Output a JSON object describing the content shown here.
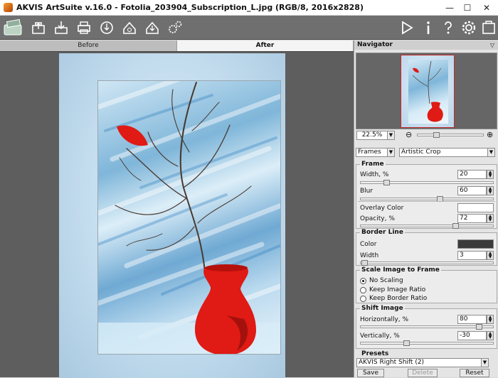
{
  "window": {
    "title": "AKVIS ArtSuite v.16.0 - Fotolia_203904_Subscription_L.jpg (RGB/8, 2016x2828)",
    "minimize": "—",
    "maximize": "☐",
    "close": "✕"
  },
  "tabs": {
    "before": "Before",
    "after": "After"
  },
  "navigator": {
    "title": "Navigator",
    "zoom": "22.5%",
    "zoom_out": "⊖",
    "zoom_in": "⊕"
  },
  "effect": {
    "category": "Frames",
    "frame_type": "Artistic Crop"
  },
  "frame": {
    "title": "Frame",
    "width_label": "Width, %",
    "width_value": "20",
    "width_level": 0.2,
    "blur_label": "Blur",
    "blur_value": "60",
    "blur_level": 0.6,
    "overlay_color_label": "Overlay Color",
    "overlay_color": "#ffffff",
    "opacity_label": "Opacity, %",
    "opacity_value": "72",
    "opacity_level": 0.72
  },
  "border_line": {
    "title": "Border Line",
    "color_label": "Color",
    "color": "#3a3a3a",
    "width_label": "Width",
    "width_value": "3",
    "width_level": 0.03
  },
  "scale": {
    "title": "Scale Image to Frame",
    "options": [
      "No Scaling",
      "Keep Image Ratio",
      "Keep Border Ratio"
    ],
    "selected": 0
  },
  "shift": {
    "title": "Shift Image",
    "h_label": "Horizontally, %",
    "h_value": "80",
    "h_level": 0.9,
    "v_label": "Vertically, %",
    "v_value": "-30",
    "v_level": 0.35
  },
  "presets": {
    "title": "Presets",
    "current": "AKVIS Right Shift (2)",
    "save": "Save",
    "delete": "Delete",
    "reset": "Reset"
  },
  "colors": {
    "toolbar": "#6f6f6f",
    "vase": "#e01a14",
    "frame_border": "#c62828"
  }
}
